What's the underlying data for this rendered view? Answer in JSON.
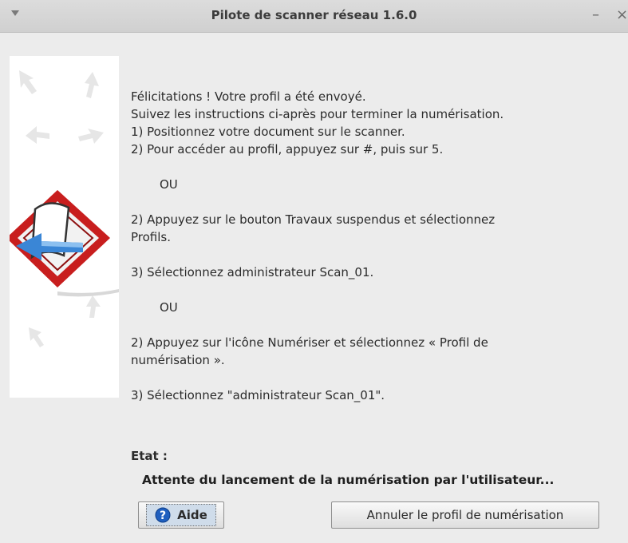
{
  "window": {
    "title": "Pilote de scanner réseau 1.6.0",
    "minimize_symbol": "–",
    "close_symbol": "×"
  },
  "message": {
    "lines": [
      "Félicitations ! Votre profil a été envoyé.",
      "Suivez les instructions ci-après pour terminer la numérisation.",
      "1) Positionnez votre document sur le scanner.",
      "2) Pour accéder au profil, appuyez sur #, puis sur 5.",
      "OU",
      "2) Appuyez sur le bouton Travaux suspendus et sélectionnez",
      "Profils.",
      "3) Sélectionnez administrateur Scan_01.",
      "OU",
      "2) Appuyez sur l'icône Numériser et sélectionnez « Profil de",
      "numérisation ».",
      "3) Sélectionnez \"administrateur Scan_01\"."
    ]
  },
  "status": {
    "label": "Etat :",
    "text": "Attente du lancement de la numérisation par l'utilisateur..."
  },
  "buttons": {
    "help_label": "Aide",
    "cancel_label": "Annuler le profil de numérisation"
  },
  "icons": {
    "side_image": "scanner-profile-illustration",
    "help": "help-question-icon"
  }
}
